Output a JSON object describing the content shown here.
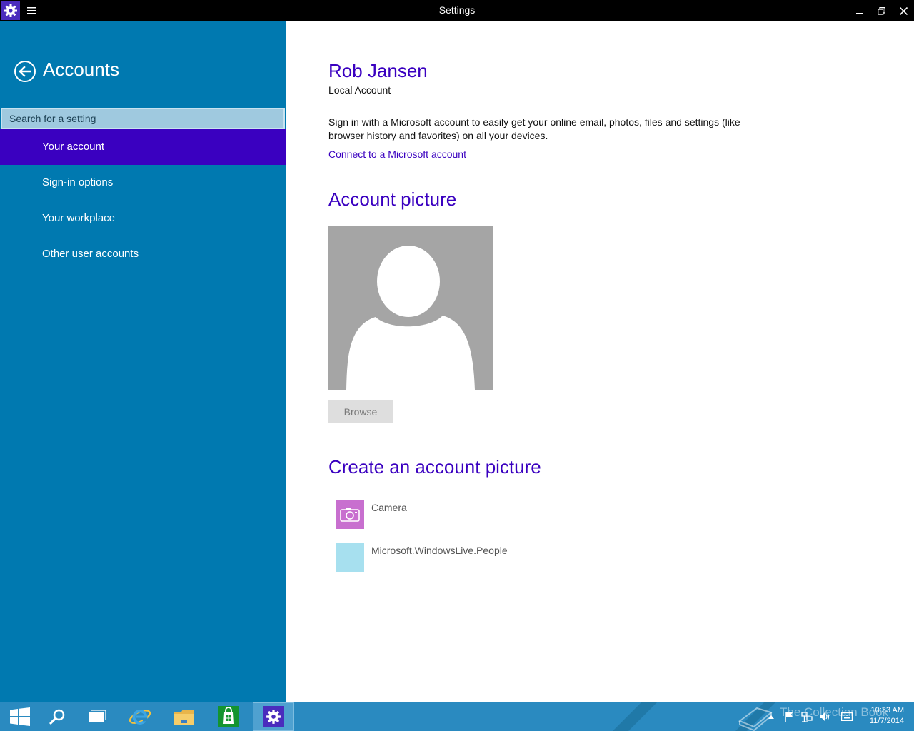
{
  "window": {
    "title": "Settings",
    "icon": "gear-icon",
    "menu_icon": "hamburger-menu-icon",
    "controls": [
      "minimize-icon",
      "restore-icon",
      "close-icon"
    ]
  },
  "sidebar": {
    "back_icon": "back-arrow-icon",
    "title": "Accounts",
    "search_placeholder": "Search for a setting",
    "items": [
      {
        "label": "Your account",
        "active": true
      },
      {
        "label": "Sign-in options",
        "active": false
      },
      {
        "label": "Your workplace",
        "active": false
      },
      {
        "label": "Other user accounts",
        "active": false
      }
    ]
  },
  "main": {
    "user_name": "Rob Jansen",
    "account_type": "Local Account",
    "description": "Sign in with a Microsoft account to easily get your online email, photos, files and settings (like browser history and favorites) on all your devices.",
    "connect_link": "Connect to a Microsoft account",
    "picture_heading": "Account picture",
    "browse_label": "Browse",
    "create_heading": "Create an account picture",
    "create_items": [
      {
        "label": "Camera",
        "icon": "camera-icon",
        "color": "#c86fcf"
      },
      {
        "label": "Microsoft.WindowsLive.People",
        "icon": "people-app-icon",
        "color": "#a7e0ef"
      }
    ]
  },
  "taskbar": {
    "apps": [
      "windows-start-icon",
      "search-icon",
      "task-view-icon",
      "internet-explorer-icon",
      "file-explorer-icon",
      "store-icon",
      "settings-icon"
    ],
    "watermark": "The Collection Book",
    "tray": [
      "show-hidden-icons",
      "action-center-flag-icon",
      "network-icon",
      "volume-icon",
      "keyboard-icon"
    ],
    "time": "10:33 AM",
    "date": "11/7/2014"
  },
  "colors": {
    "accent": "#3a00c0",
    "sidebar": "#0079b0",
    "taskbar": "#2a8ac0"
  }
}
